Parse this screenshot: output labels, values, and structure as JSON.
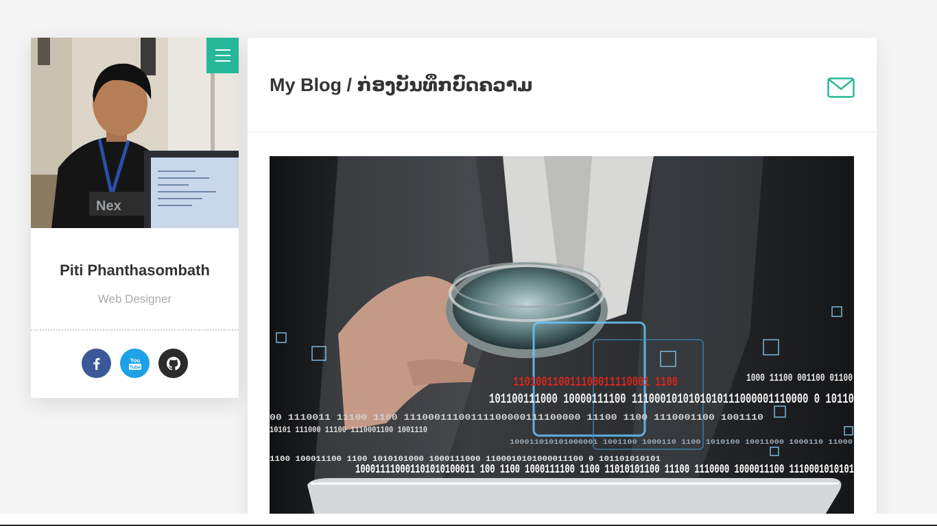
{
  "profile": {
    "name": "Piti Phanthasombath",
    "title": "Web Designer",
    "photo_description_icon": "portrait-photo",
    "menu_icon": "hamburger-menu-icon",
    "social": [
      {
        "network": "facebook",
        "icon": "facebook-icon",
        "color": "#3b5998"
      },
      {
        "network": "youtube",
        "icon": "youtube-icon",
        "color": "#1ea1e6"
      },
      {
        "network": "github",
        "icon": "github-icon",
        "color": "#2b2b2b"
      }
    ]
  },
  "blog": {
    "title": "My Blog / ກ່ອງບັນທຶກບົດຄວາມ",
    "mail_icon": "mail-envelope-icon",
    "hero_icon": "magnifying-glass-binary-data-image"
  },
  "colors": {
    "accent": "#27b89a",
    "background": "#f4f4f4",
    "card": "#ffffff",
    "text_dark": "#333333",
    "text_muted": "#aaaaaa"
  }
}
